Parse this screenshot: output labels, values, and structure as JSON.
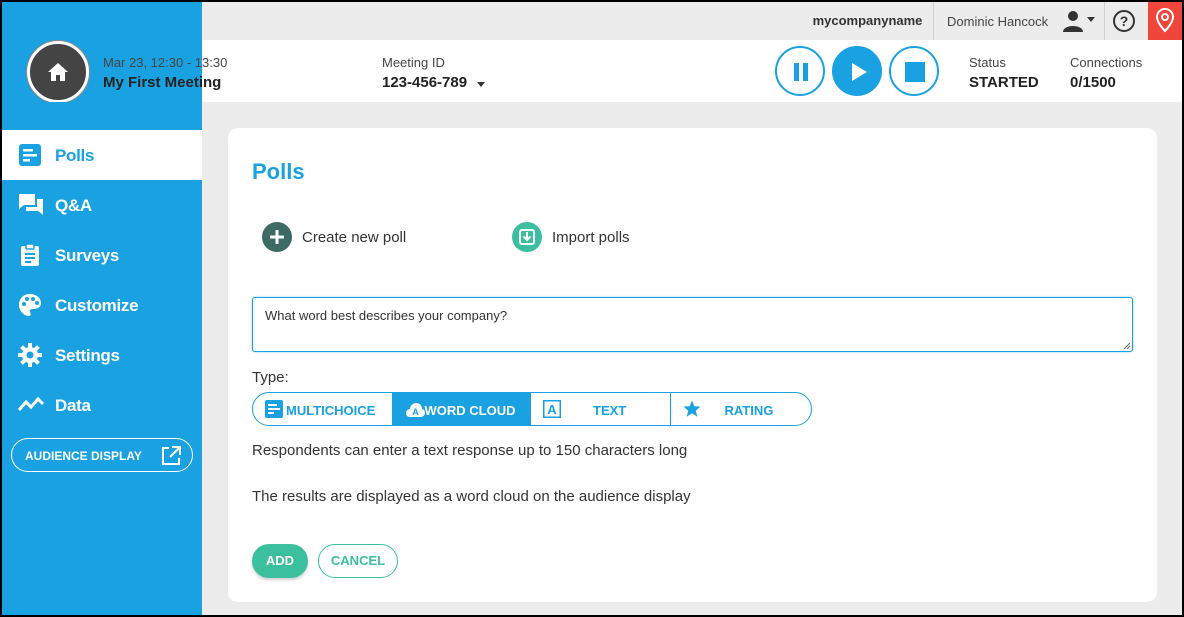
{
  "topbar": {
    "company": "mycompanyname",
    "user_name": "Dominic Hancock",
    "help_glyph": "?"
  },
  "meeting": {
    "date_time": "Mar 23, 12:30 - 13:30",
    "name": "My First Meeting",
    "id_label": "Meeting ID",
    "id_value": "123-456-789",
    "status_label": "Status",
    "status_value": "STARTED",
    "connections_label": "Connections",
    "connections_value": "0/1500"
  },
  "sidebar": {
    "items": [
      {
        "label": "Polls",
        "icon": "polls-icon",
        "active": true
      },
      {
        "label": "Q&A",
        "icon": "chat-icon",
        "active": false
      },
      {
        "label": "Surveys",
        "icon": "clipboard-icon",
        "active": false
      },
      {
        "label": "Customize",
        "icon": "palette-icon",
        "active": false
      },
      {
        "label": "Settings",
        "icon": "gear-icon",
        "active": false
      },
      {
        "label": "Data",
        "icon": "chart-line-icon",
        "active": false
      }
    ],
    "audience_display": "AUDIENCE DISPLAY"
  },
  "main": {
    "title": "Polls",
    "create_poll": "Create new poll",
    "import_polls": "Import polls",
    "question_value": "What word best describes your company?",
    "type_label": "Type:",
    "types": [
      {
        "label": "MULTICHOICE",
        "icon": "multichoice-icon",
        "active": false
      },
      {
        "label": "WORD CLOUD",
        "icon": "word-cloud-icon",
        "active": true
      },
      {
        "label": "TEXT",
        "icon": "text-icon",
        "active": false
      },
      {
        "label": "RATING",
        "icon": "star-icon",
        "active": false
      }
    ],
    "description_1": "Respondents can enter a text response up to 150 characters long",
    "description_2": "The results are displayed as a word cloud on the audience display",
    "add_label": "ADD",
    "cancel_label": "CANCEL"
  },
  "colors": {
    "brand_blue": "#1aa1e1",
    "accent_green": "#3cbf9f",
    "alert_red": "#f0453a",
    "dark_teal": "#3d6b63"
  }
}
